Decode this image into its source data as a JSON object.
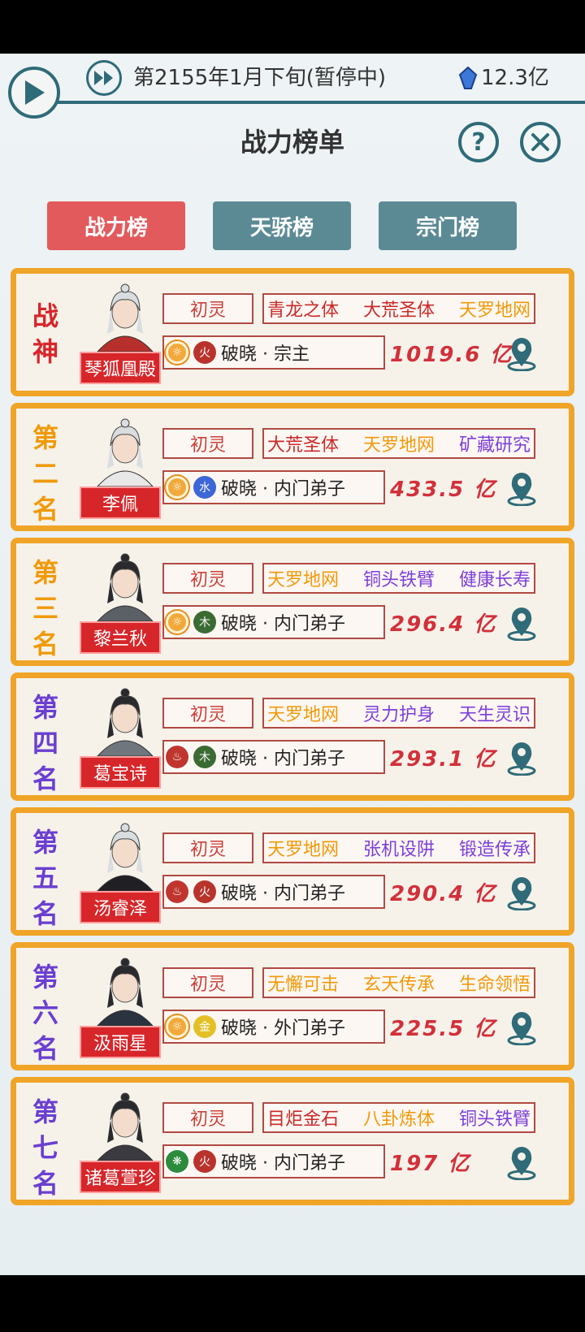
{
  "header": {
    "date": "第2155年1月下旬(暂停中)",
    "currency": "12.3亿",
    "title": "战力榜单",
    "help": "?"
  },
  "tabs": [
    {
      "label": "战力榜",
      "active": true
    },
    {
      "label": "天骄榜",
      "active": false
    },
    {
      "label": "宗门榜",
      "active": false
    }
  ],
  "entries": [
    {
      "rank_chars": [
        "战",
        "神"
      ],
      "rank_color": "#d7262a",
      "name": "琴狐凰殿",
      "realm": "初灵",
      "traits": [
        {
          "t": "青龙之体",
          "c": "red"
        },
        {
          "t": "大荒圣体",
          "c": "red"
        },
        {
          "t": "天罗地网",
          "c": "orange"
        }
      ],
      "sect_orb": "sun",
      "element": "火",
      "element_type": "fire",
      "sect": "破晓 · 宗主",
      "power": "1019.6 亿"
    },
    {
      "rank_chars": [
        "第",
        "二",
        "名"
      ],
      "rank_color": "#f09a0a",
      "name": "李佩",
      "realm": "初灵",
      "traits": [
        {
          "t": "大荒圣体",
          "c": "red"
        },
        {
          "t": "天罗地网",
          "c": "orange"
        },
        {
          "t": "矿藏研究",
          "c": "purple"
        }
      ],
      "sect_orb": "sun",
      "element": "水",
      "element_type": "water",
      "sect": "破晓 · 内门弟子",
      "power": "433.5 亿"
    },
    {
      "rank_chars": [
        "第",
        "三",
        "名"
      ],
      "rank_color": "#f09a0a",
      "name": "黎兰秋",
      "realm": "初灵",
      "traits": [
        {
          "t": "天罗地网",
          "c": "orange"
        },
        {
          "t": "铜头铁臂",
          "c": "purple"
        },
        {
          "t": "健康长寿",
          "c": "purple"
        }
      ],
      "sect_orb": "sun",
      "element": "木",
      "element_type": "wood",
      "sect": "破晓 · 内门弟子",
      "power": "296.4 亿"
    },
    {
      "rank_chars": [
        "第",
        "四",
        "名"
      ],
      "rank_color": "#6b3fd0",
      "name": "葛宝诗",
      "realm": "初灵",
      "traits": [
        {
          "t": "天罗地网",
          "c": "orange"
        },
        {
          "t": "灵力护身",
          "c": "purple"
        },
        {
          "t": "天生灵识",
          "c": "purple"
        }
      ],
      "sect_orb": "red",
      "element": "木",
      "element_type": "wood",
      "sect": "破晓 · 内门弟子",
      "power": "293.1 亿"
    },
    {
      "rank_chars": [
        "第",
        "五",
        "名"
      ],
      "rank_color": "#6b3fd0",
      "name": "汤睿泽",
      "realm": "初灵",
      "traits": [
        {
          "t": "天罗地网",
          "c": "orange"
        },
        {
          "t": "张机设阱",
          "c": "purple"
        },
        {
          "t": "锻造传承",
          "c": "purple"
        }
      ],
      "sect_orb": "red",
      "element": "火",
      "element_type": "fire",
      "sect": "破晓 · 内门弟子",
      "power": "290.4 亿"
    },
    {
      "rank_chars": [
        "第",
        "六",
        "名"
      ],
      "rank_color": "#6b3fd0",
      "name": "汲雨星",
      "realm": "初灵",
      "traits": [
        {
          "t": "无懈可击",
          "c": "orange"
        },
        {
          "t": "玄天传承",
          "c": "orange"
        },
        {
          "t": "生命领悟",
          "c": "orange"
        }
      ],
      "sect_orb": "sun",
      "element": "金",
      "element_type": "metal",
      "sect": "破晓 · 外门弟子",
      "power": "225.5 亿"
    },
    {
      "rank_chars": [
        "第",
        "七",
        "名"
      ],
      "rank_color": "#6b3fd0",
      "name": "诸葛萱珍",
      "realm": "初灵",
      "traits": [
        {
          "t": "目炬金石",
          "c": "red"
        },
        {
          "t": "八卦炼体",
          "c": "orange"
        },
        {
          "t": "铜头铁臂",
          "c": "purple"
        }
      ],
      "sect_orb": "green",
      "element": "火",
      "element_type": "fire",
      "sect": "破晓 · 内门弟子",
      "power": "197 亿"
    }
  ]
}
